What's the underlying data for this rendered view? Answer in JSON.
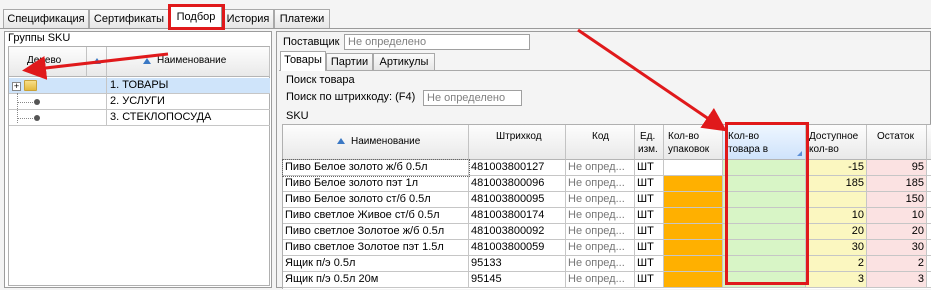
{
  "tabs": [
    "Спецификация",
    "Сертификаты",
    "Подбор",
    "История",
    "Платежи"
  ],
  "left": {
    "title": "Группы SKU",
    "col_tree": "Дерево",
    "col_name": "Наименование",
    "items": [
      "1. ТОВАРЫ",
      "2. УСЛУГИ",
      "3. СТЕКЛОПОСУДА"
    ]
  },
  "right": {
    "supplier_label": "Поставщик",
    "supplier_value": "Не определено",
    "subtabs": [
      "Товары",
      "Партии",
      "Артикулы"
    ],
    "search_group": "Поиск товара",
    "barcode_label": "Поиск по штрихкоду: (F4)",
    "barcode_value": "Не определено",
    "sku_label": "SKU",
    "columns": {
      "name": "Наименование",
      "barcode": "Штрихкод",
      "code": "Код",
      "unit1": "Ед.",
      "unit2": "изм.",
      "pack1": "Кол-во",
      "pack2": "упаковок",
      "qty1": "Кол-во",
      "qty2": "товара в",
      "avail1": "Доступное",
      "avail2": "кол-во",
      "stock": "Остаток"
    },
    "rows": [
      {
        "name": "Пиво Белое золото ж/б 0.5л",
        "barcode": "481003800127",
        "code": "Не опред...",
        "unit": "ШТ",
        "avail": "-15",
        "stock": "95"
      },
      {
        "name": "Пиво Белое золото пэт 1л",
        "barcode": "481003800096",
        "code": "Не опред...",
        "unit": "ШТ",
        "avail": "185",
        "stock": "185"
      },
      {
        "name": "Пиво Белое золото ст/б 0.5л",
        "barcode": "481003800095",
        "code": "Не опред...",
        "unit": "ШТ",
        "avail": "",
        "stock": "150"
      },
      {
        "name": "Пиво светлое Живое ст/б 0.5л",
        "barcode": "481003800174",
        "code": "Не опред...",
        "unit": "ШТ",
        "avail": "10",
        "stock": "10"
      },
      {
        "name": "Пиво светлое Золотое ж/б 0.5л",
        "barcode": "481003800092",
        "code": "Не опред...",
        "unit": "ШТ",
        "avail": "20",
        "stock": "20"
      },
      {
        "name": "Пиво светлое Золотое пэт 1.5л",
        "barcode": "481003800059",
        "code": "Не опред...",
        "unit": "ШТ",
        "avail": "30",
        "stock": "30"
      },
      {
        "name": "Ящик п/э 0.5л",
        "barcode": "95133",
        "code": "Не опред...",
        "unit": "ШТ",
        "avail": "2",
        "stock": "2"
      },
      {
        "name": "Ящик п/э 0.5л 20м",
        "barcode": "95145",
        "code": "Не опред...",
        "unit": "ШТ",
        "avail": "3",
        "stock": "3"
      }
    ]
  },
  "colors": {
    "accent_red": "#e0191b",
    "orange": "#ffb000",
    "green": "#d8f5c6",
    "yellow": "#fbf7c0",
    "pink": "#fbe2e2"
  }
}
